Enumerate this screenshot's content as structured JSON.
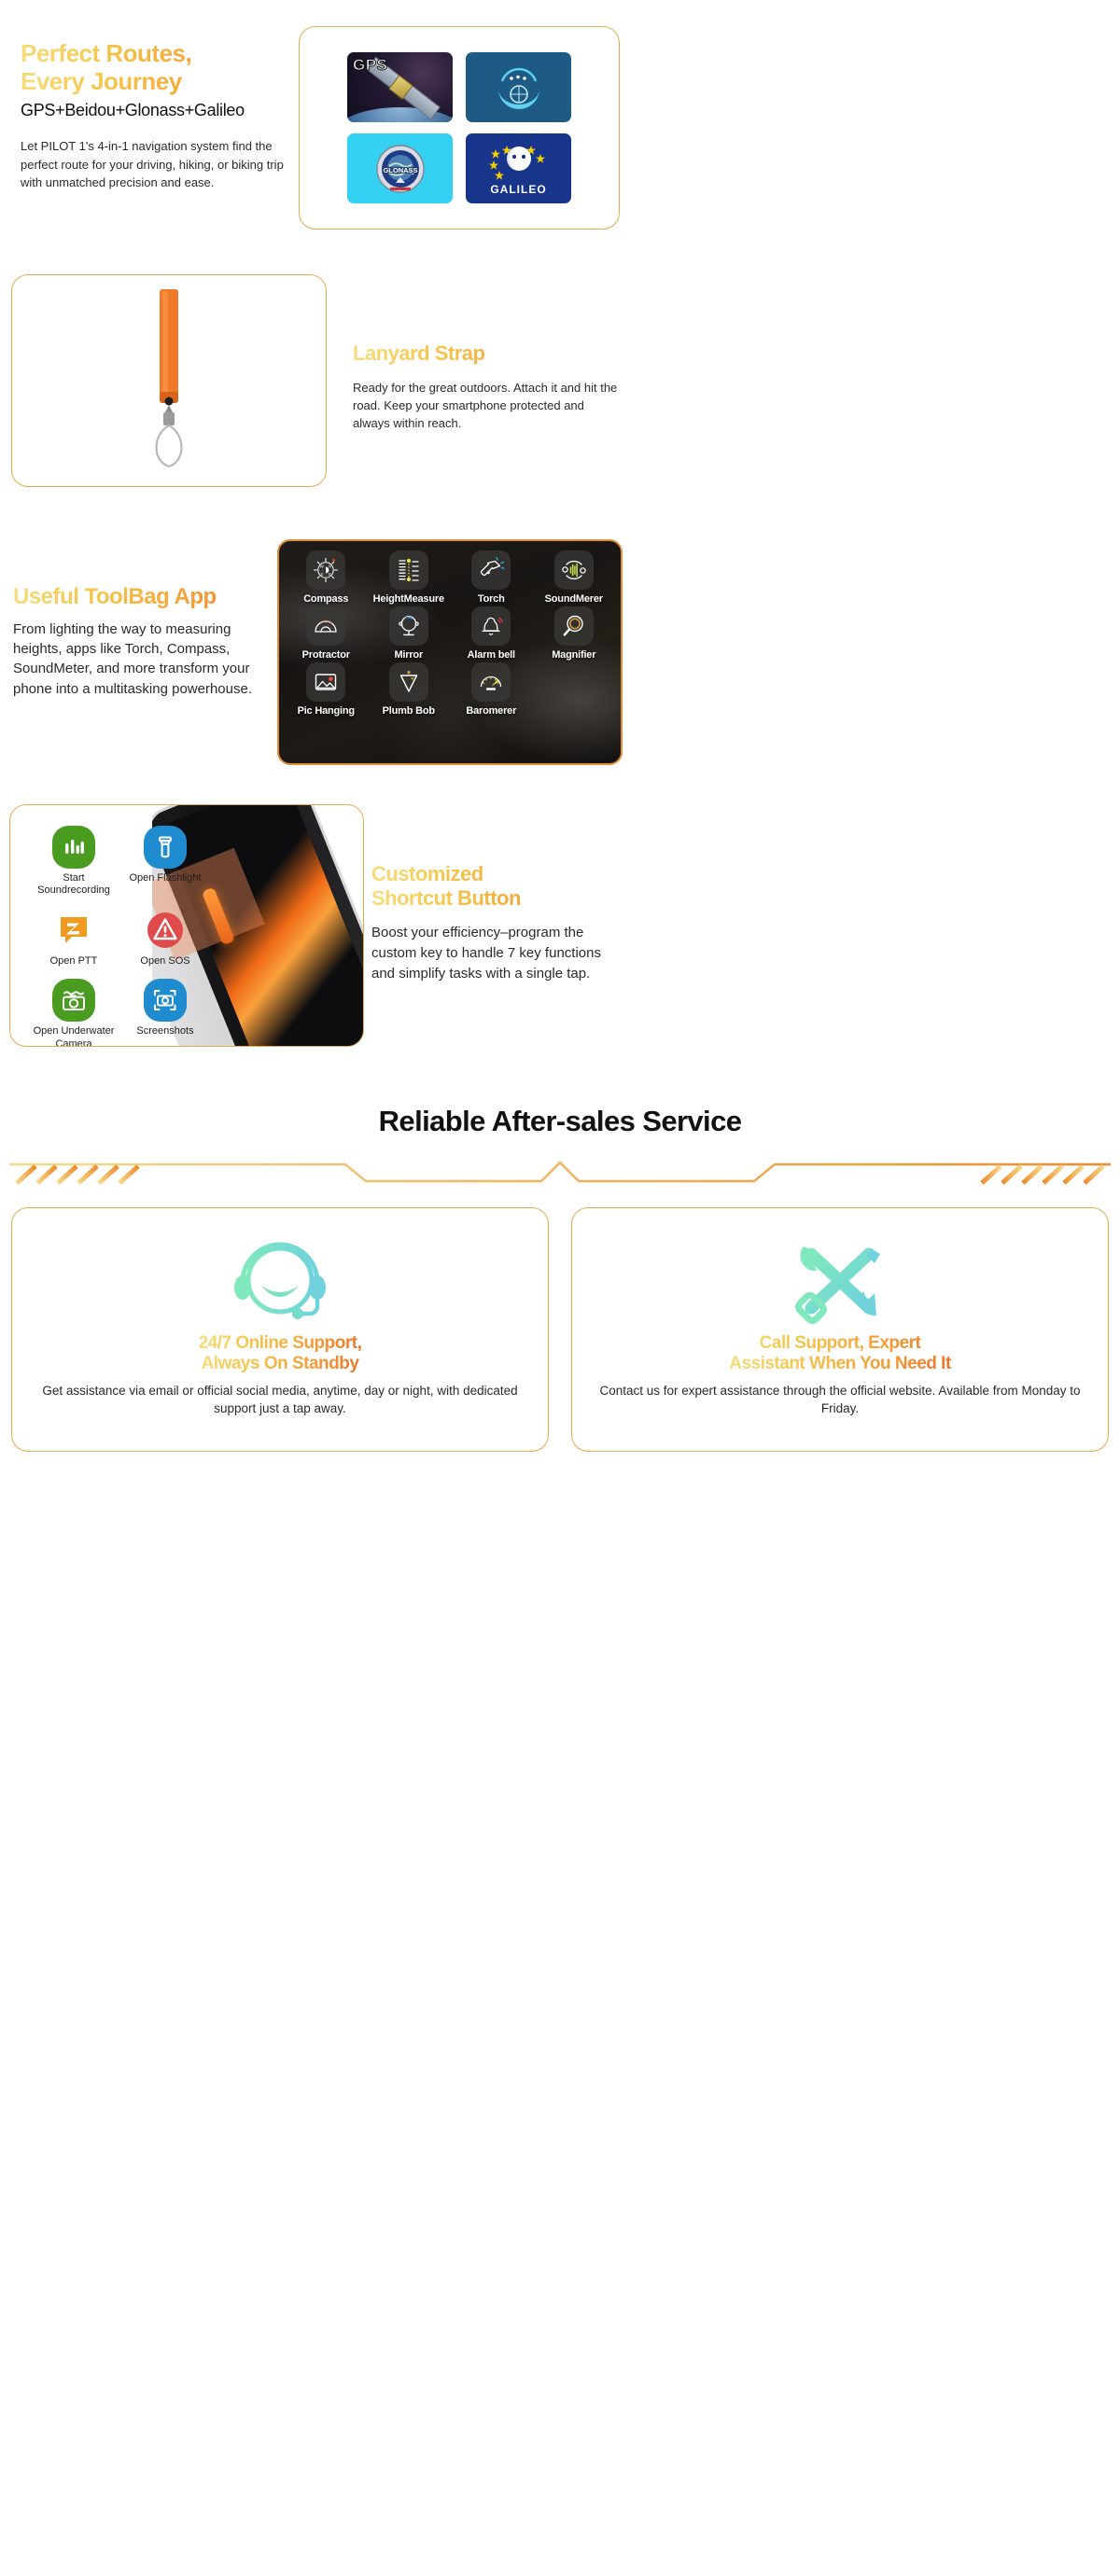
{
  "gps_section": {
    "heading_line1": "Perfect Routes,",
    "heading_line2": "Every Journey",
    "subheading": "GPS+Beidou+Glonass+Galileo",
    "body": "Let PILOT 1's 4-in-1 navigation system find the perfect route for your driving, hiking, or biking trip with unmatched precision and ease.",
    "logos": [
      {
        "name": "gps-logo",
        "label": "GPS",
        "bg": "#1b1226"
      },
      {
        "name": "beidou-logo",
        "label": "",
        "bg": "#1d5b84"
      },
      {
        "name": "glonass-logo",
        "label": "GLONASS",
        "bg": "#35d1f2"
      },
      {
        "name": "galileo-logo",
        "label": "GALILEO",
        "bg": "#18358c"
      }
    ]
  },
  "lanyard_section": {
    "heading": "Lanyard Strap",
    "body": "Ready for the great outdoors. Attach it and hit the road. Keep your smartphone protected and always within reach.",
    "image_alt": "orange lanyard strap"
  },
  "toolbag_section": {
    "heading": "Useful ToolBag App",
    "body": "From lighting the way to measuring heights, apps like Torch, Compass, SoundMeter, and more transform your phone into a multitasking powerhouse.",
    "tools": [
      {
        "label": "Compass",
        "icon": "compass-icon"
      },
      {
        "label": "HeightMeasure",
        "icon": "height-measure-icon"
      },
      {
        "label": "Torch",
        "icon": "torch-icon"
      },
      {
        "label": "SoundMerer",
        "icon": "sound-meter-icon"
      },
      {
        "label": "Protractor",
        "icon": "protractor-icon"
      },
      {
        "label": "Mirror",
        "icon": "mirror-icon"
      },
      {
        "label": "Alarm bell",
        "icon": "alarm-bell-icon"
      },
      {
        "label": "Magnifier",
        "icon": "magnifier-icon"
      },
      {
        "label": "Pic Hanging",
        "icon": "pic-hanging-icon"
      },
      {
        "label": "Plumb Bob",
        "icon": "plumb-bob-icon"
      },
      {
        "label": "Baromerer",
        "icon": "barometer-icon"
      },
      {
        "label": "",
        "icon": ""
      }
    ]
  },
  "shortcut_section": {
    "heading_line1": "Customized",
    "heading_line2": "Shortcut Button",
    "body": "Boost your efficiency–program the custom key to handle 7 key functions and simplify tasks with a single tap.",
    "apps": [
      {
        "label": "Start Soundrecording",
        "icon": "sound-recording-icon",
        "color": "#4a9c21"
      },
      {
        "label": "Open Flashlight",
        "icon": "flashlight-icon",
        "color": "#1e8ccf"
      },
      {
        "label": "Open PTT",
        "icon": "ptt-icon",
        "color": "#f09a1e"
      },
      {
        "label": "Open SOS",
        "icon": "sos-icon",
        "color": "#e04a4a"
      },
      {
        "label": "Open Underwater Camera",
        "icon": "underwater-camera-icon",
        "color": "#4a9c21"
      },
      {
        "label": "Screenshots",
        "icon": "screenshot-icon",
        "color": "#1e8ccf"
      }
    ]
  },
  "aftersales_section": {
    "title": "Reliable After-sales Service",
    "cards": [
      {
        "icon": "headset-support-icon",
        "heading_line1": "24/7 Online Support,",
        "heading_line2": "Always On Standby",
        "body": "Get assistance via email or official social media, anytime, day or night, with dedicated support just a tap away."
      },
      {
        "icon": "wrench-screwdriver-icon",
        "heading_line1": "Call Support, Expert",
        "heading_line2": "Assistant When You Need It",
        "body": "Contact us for expert assistance through the official website. Available from Monday to Friday."
      }
    ]
  },
  "colors": {
    "accent_light": "#f7dc7a",
    "accent_mid": "#f5a93a",
    "accent_dark": "#ef7427",
    "card_border": "#e2ac4e",
    "mint": "#7fe0bd",
    "teal": "#6fd2dd"
  }
}
